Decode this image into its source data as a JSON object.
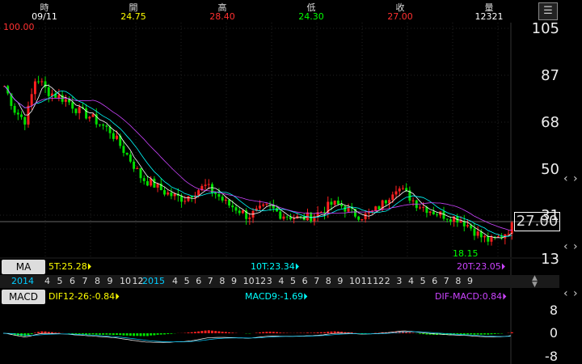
{
  "header": [
    {
      "label": "時",
      "value": "09/11",
      "color": "#ffffff"
    },
    {
      "label": "開",
      "value": "24.75",
      "color": "#ffff00"
    },
    {
      "label": "高",
      "value": "28.40",
      "color": "#ff3030"
    },
    {
      "label": "低",
      "value": "24.30",
      "color": "#00ff00"
    },
    {
      "label": "收",
      "value": "27.00",
      "color": "#ff3030"
    },
    {
      "label": "量",
      "value": "12321",
      "color": "#ffffff"
    }
  ],
  "menu_icon": "menu-icon",
  "price_chart": {
    "high_marker": "100.00",
    "low_marker": "18.15",
    "y_labels": [
      "105",
      "87",
      "68",
      "50",
      "31",
      "13"
    ],
    "current_price": "27.00"
  },
  "ma": {
    "button": "MA",
    "ma5": "5T:25.28",
    "ma10": "10T:23.34",
    "ma20": "20T:23.05"
  },
  "timeline": {
    "year1": "2014",
    "months1": [
      "4",
      "5",
      "6",
      "7",
      "8",
      "9",
      "10",
      "12"
    ],
    "year2": "2015",
    "months2": [
      "4",
      "5",
      "6",
      "7",
      "8",
      "9",
      "10",
      "12",
      "3",
      "4",
      "5",
      "6",
      "7",
      "8",
      "9",
      "10",
      "11",
      "12",
      "2",
      "3",
      "4",
      "5",
      "6",
      "7",
      "8",
      "9"
    ]
  },
  "macd": {
    "button": "MACD",
    "dif": "DIF12-26:-0.84",
    "macd9": "MACD9:-1.69",
    "osc": "DIF-MACD:0.84",
    "y_labels": [
      "8",
      "0",
      "-8"
    ]
  },
  "colors": {
    "up": "#ff2020",
    "down": "#00e000",
    "ma5": "#ffffff",
    "ma10": "#00ffff",
    "ma20": "#cc44ff"
  },
  "chart_data": {
    "type": "line",
    "title": "",
    "ylim": [
      13,
      105
    ],
    "series": [
      {
        "name": "",
        "values": [
          82,
          72,
          68,
          86,
          80,
          78,
          76,
          72,
          70,
          67,
          64,
          58,
          52,
          45,
          43,
          40,
          38,
          37,
          40,
          42,
          39,
          35,
          33,
          30,
          32,
          34,
          31,
          30,
          29,
          30,
          32,
          35,
          34,
          31,
          30,
          32,
          36,
          42,
          39,
          35,
          33,
          31,
          30,
          29,
          26,
          22,
          20,
          22,
          26
        ]
      }
    ]
  }
}
